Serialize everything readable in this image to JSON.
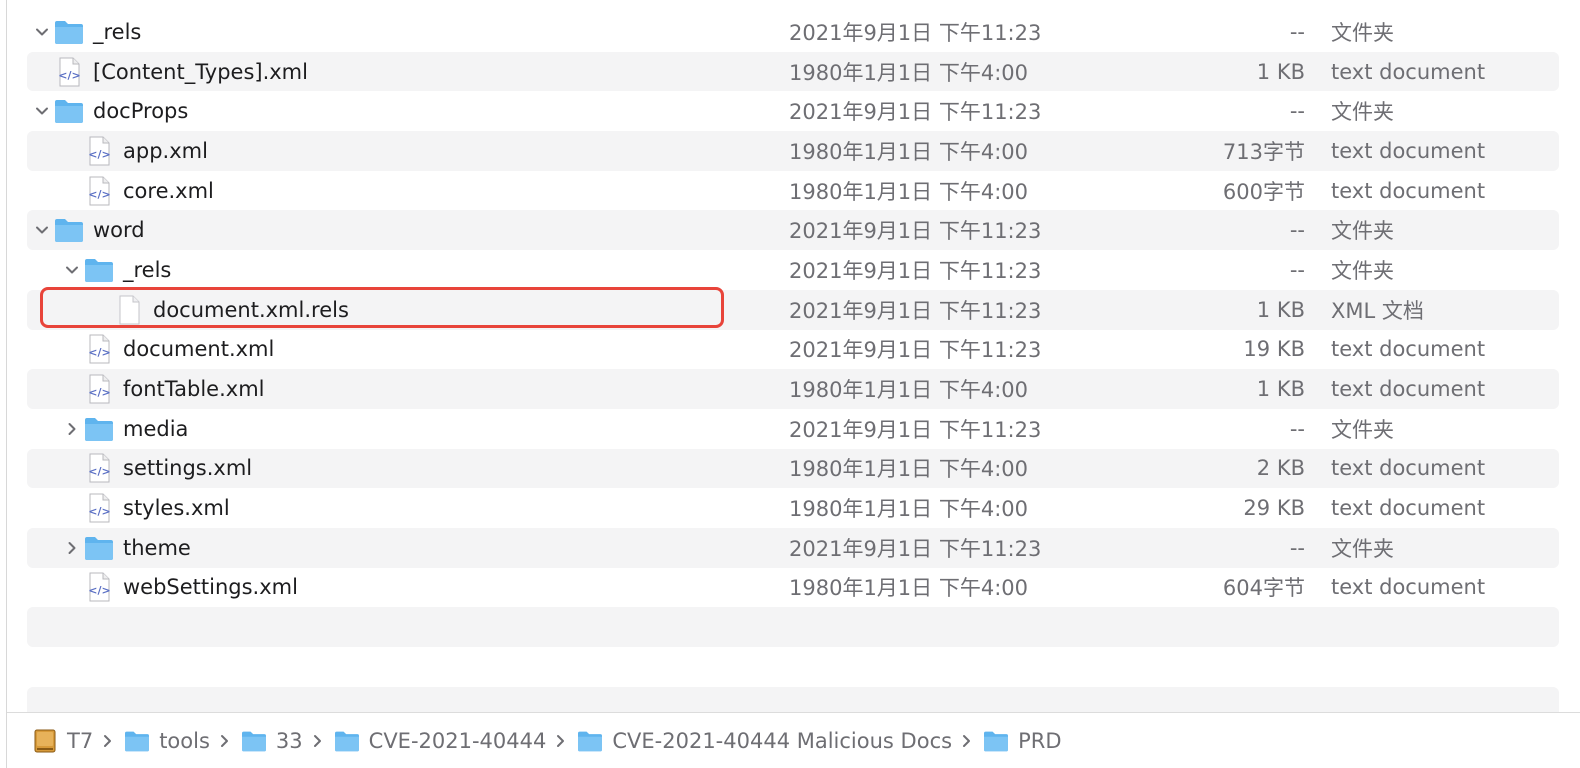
{
  "files": [
    {
      "name": "_rels",
      "date": "2021年9月1日 下午11:23",
      "size": "--",
      "kind": "文件夹",
      "type": "folder",
      "depth": 0,
      "disclosure": "open"
    },
    {
      "name": "[Content_Types].xml",
      "date": "1980年1月1日 下午4:00",
      "size": "1 KB",
      "kind": "text document",
      "type": "xml",
      "depth": 0,
      "disclosure": "none"
    },
    {
      "name": "docProps",
      "date": "2021年9月1日 下午11:23",
      "size": "--",
      "kind": "文件夹",
      "type": "folder",
      "depth": 0,
      "disclosure": "open"
    },
    {
      "name": "app.xml",
      "date": "1980年1月1日 下午4:00",
      "size": "713字节",
      "kind": "text document",
      "type": "xml",
      "depth": 1,
      "disclosure": "none"
    },
    {
      "name": "core.xml",
      "date": "1980年1月1日 下午4:00",
      "size": "600字节",
      "kind": "text document",
      "type": "xml",
      "depth": 1,
      "disclosure": "none"
    },
    {
      "name": "word",
      "date": "2021年9月1日 下午11:23",
      "size": "--",
      "kind": "文件夹",
      "type": "folder",
      "depth": 0,
      "disclosure": "open"
    },
    {
      "name": "_rels",
      "date": "2021年9月1日 下午11:23",
      "size": "--",
      "kind": "文件夹",
      "type": "folder",
      "depth": 1,
      "disclosure": "open"
    },
    {
      "name": "document.xml.rels",
      "date": "2021年9月1日 下午11:23",
      "size": "1 KB",
      "kind": "XML 文档",
      "type": "blank",
      "depth": 2,
      "disclosure": "none"
    },
    {
      "name": "document.xml",
      "date": "2021年9月1日 下午11:23",
      "size": "19 KB",
      "kind": "text document",
      "type": "xml",
      "depth": 1,
      "disclosure": "none"
    },
    {
      "name": "fontTable.xml",
      "date": "1980年1月1日 下午4:00",
      "size": "1 KB",
      "kind": "text document",
      "type": "xml",
      "depth": 1,
      "disclosure": "none"
    },
    {
      "name": "media",
      "date": "2021年9月1日 下午11:23",
      "size": "--",
      "kind": "文件夹",
      "type": "folder",
      "depth": 1,
      "disclosure": "closed"
    },
    {
      "name": "settings.xml",
      "date": "1980年1月1日 下午4:00",
      "size": "2 KB",
      "kind": "text document",
      "type": "xml",
      "depth": 1,
      "disclosure": "none"
    },
    {
      "name": "styles.xml",
      "date": "1980年1月1日 下午4:00",
      "size": "29 KB",
      "kind": "text document",
      "type": "xml",
      "depth": 1,
      "disclosure": "none"
    },
    {
      "name": "theme",
      "date": "2021年9月1日 下午11:23",
      "size": "--",
      "kind": "文件夹",
      "type": "folder",
      "depth": 1,
      "disclosure": "closed"
    },
    {
      "name": "webSettings.xml",
      "date": "1980年1月1日 下午4:00",
      "size": "604字节",
      "kind": "text document",
      "type": "xml",
      "depth": 1,
      "disclosure": "none"
    }
  ],
  "highlighted_file": "document.xml.rels",
  "pathbar": [
    {
      "label": "T7",
      "icon": "drive-icon"
    },
    {
      "label": "tools",
      "icon": "folder-icon"
    },
    {
      "label": "33",
      "icon": "folder-icon"
    },
    {
      "label": "CVE-2021-40444",
      "icon": "folder-icon"
    },
    {
      "label": "CVE-2021-40444 Malicious Docs",
      "icon": "folder-icon"
    },
    {
      "label": "PRD",
      "icon": "folder-icon"
    }
  ],
  "colors": {
    "folder": "#5fb4ee",
    "highlight": "#e8443a",
    "stripe": "#f4f4f5"
  }
}
